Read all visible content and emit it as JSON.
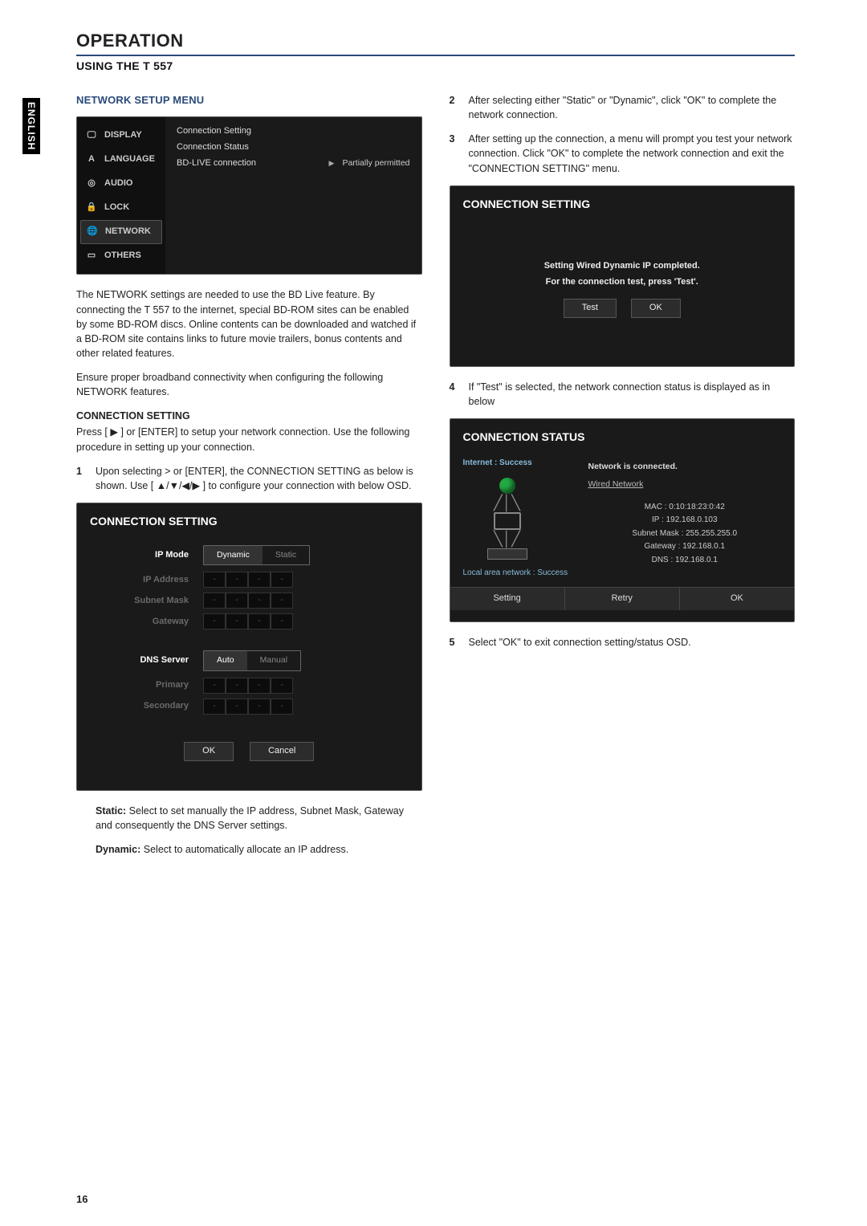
{
  "side_tab": "ENGLISH",
  "h1": "OPERATION",
  "h2": "USING THE T 557",
  "page_number": "16",
  "left": {
    "section_title": "NETWORK SETUP MENU",
    "osd_menu": {
      "items": [
        {
          "label": "DISPLAY"
        },
        {
          "label": "LANGUAGE"
        },
        {
          "label": "AUDIO"
        },
        {
          "label": "LOCK"
        },
        {
          "label": "NETWORK",
          "selected": true
        },
        {
          "label": "OTHERS"
        }
      ],
      "pane": {
        "l1": "Connection Setting",
        "l2": "Connection Status",
        "l3": "BD-LIVE connection",
        "l3v": "Partially permitted"
      }
    },
    "p1": "The NETWORK settings are needed to use the BD Live feature. By connecting the T 557 to the internet, special BD-ROM sites can be enabled by some BD-ROM discs.  Online contents can be downloaded and watched if a BD-ROM site contains links to future movie trailers, bonus contents and other related features.",
    "p2": "Ensure proper broadband connectivity when configuring the following NETWORK features.",
    "conn_head": "CONNECTION SETTING",
    "p3": "Press [ ▶ ] or [ENTER] to setup your network connection. Use the following procedure in setting up your connection.",
    "step1_n": "1",
    "step1": "Upon selecting > or [ENTER], the CONNECTION SETTING as below is shown. Use [ ▲/▼/◀/▶ ] to configure your connection with below OSD.",
    "osd_conn": {
      "title": "CONNECTION SETTING",
      "ip_mode": "IP Mode",
      "ip_mode_a": "Dynamic",
      "ip_mode_b": "Static",
      "ip_address": "IP Address",
      "subnet": "Subnet Mask",
      "gateway": "Gateway",
      "dns": "DNS Server",
      "dns_a": "Auto",
      "dns_b": "Manual",
      "primary": "Primary",
      "secondary": "Secondary",
      "ok": "OK",
      "cancel": "Cancel"
    },
    "static_lbl": "Static:",
    "static_txt": " Select to set manually the IP address, Subnet Mask, Gateway and consequently the DNS Server settings.",
    "dynamic_lbl": "Dynamic:",
    "dynamic_txt": " Select to automatically allocate an IP address."
  },
  "right": {
    "step2_n": "2",
    "step2": "After selecting either \"Static\" or \"Dynamic\", click \"OK\" to complete the network connection.",
    "step3_n": "3",
    "step3": "After setting up the connection, a menu will prompt you test your network connection.  Click \"OK\" to complete the network connection and exit the \"CONNECTION SETTING\" menu.",
    "osd_prompt": {
      "title": "CONNECTION SETTING",
      "msg1": "Setting Wired Dynamic IP completed.",
      "msg2": "For the connection test, press 'Test'.",
      "test": "Test",
      "ok": "OK"
    },
    "step4_n": "4",
    "step4": "If \"Test\" is selected, the network connection status is displayed as in below",
    "osd_status": {
      "title": "CONNECTION STATUS",
      "internet": "Internet : Success",
      "local": "Local area network : Success",
      "connected": "Network is connected.",
      "wired": "Wired Network",
      "mac": "MAC : 0:10:18:23:0:42",
      "ip": "IP : 192.168.0.103",
      "mask": "Subnet Mask : 255.255.255.0",
      "gateway": "Gateway : 192.168.0.1",
      "dns": "DNS : 192.168.0.1",
      "b_setting": "Setting",
      "b_retry": "Retry",
      "b_ok": "OK"
    },
    "step5_n": "5",
    "step5": "Select \"OK\" to exit connection setting/status OSD."
  }
}
